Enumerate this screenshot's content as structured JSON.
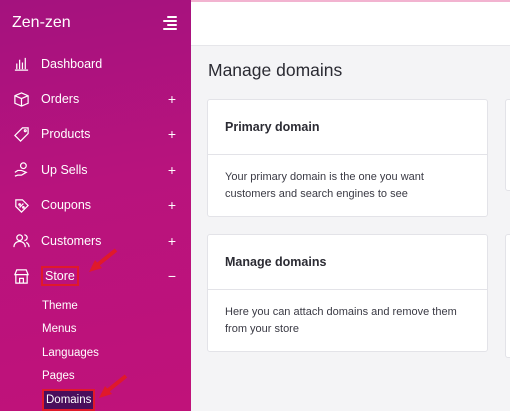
{
  "sidebar": {
    "brand": "Zen-zen",
    "items": [
      {
        "label": "Dashboard",
        "toggle": ""
      },
      {
        "label": "Orders",
        "toggle": "+"
      },
      {
        "label": "Products",
        "toggle": "+"
      },
      {
        "label": "Up Sells",
        "toggle": "+"
      },
      {
        "label": "Coupons",
        "toggle": "+"
      },
      {
        "label": "Customers",
        "toggle": "+"
      },
      {
        "label": "Store",
        "toggle": "−"
      }
    ],
    "store_subitems": [
      "Theme",
      "Menus",
      "Languages",
      "Pages",
      "Domains"
    ]
  },
  "main": {
    "title": "Manage domains",
    "cards": [
      {
        "heading": "Primary domain",
        "text": "Your primary domain is the one you want customers and search engines to see"
      },
      {
        "heading": "Manage domains",
        "text": "Here you can attach domains and remove them from your store"
      }
    ]
  },
  "colors": {
    "sidebar_gradient_start": "#a4127e",
    "sidebar_gradient_end": "#c0127a",
    "highlight_border": "#e0192b",
    "active_sub_bg": "#4a0e5c"
  }
}
